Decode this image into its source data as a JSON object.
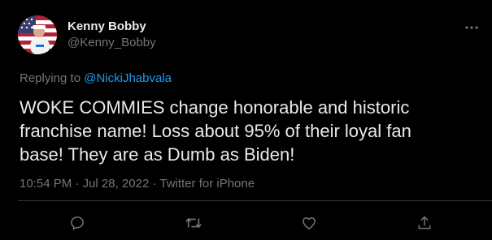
{
  "author": {
    "display_name": "Kenny Bobby",
    "handle": "@Kenny_Bobby",
    "avatar_icon": "avatar-flag-photo"
  },
  "reply_context": {
    "prefix": "Replying to ",
    "mention": "@NickiJhabvala"
  },
  "tweet": {
    "text": "WOKE COMMIES change honorable and historic\nfranchise name! Loss about 95% of their loyal fan\nbase! They are as Dumb as Biden!"
  },
  "meta": {
    "time": "10:54 PM",
    "separator1": " · ",
    "date": "Jul 28, 2022",
    "separator2": " · ",
    "source": "Twitter for iPhone"
  },
  "actions": {
    "reply_icon": "reply-icon",
    "retweet_icon": "retweet-icon",
    "like_icon": "heart-icon",
    "share_icon": "share-icon",
    "more_icon": "more-dots-icon"
  },
  "colors": {
    "background": "#000000",
    "primary_text": "#e7e9ea",
    "secondary_text": "#71767b",
    "accent": "#1d9bf0",
    "divider": "#2f3336"
  }
}
